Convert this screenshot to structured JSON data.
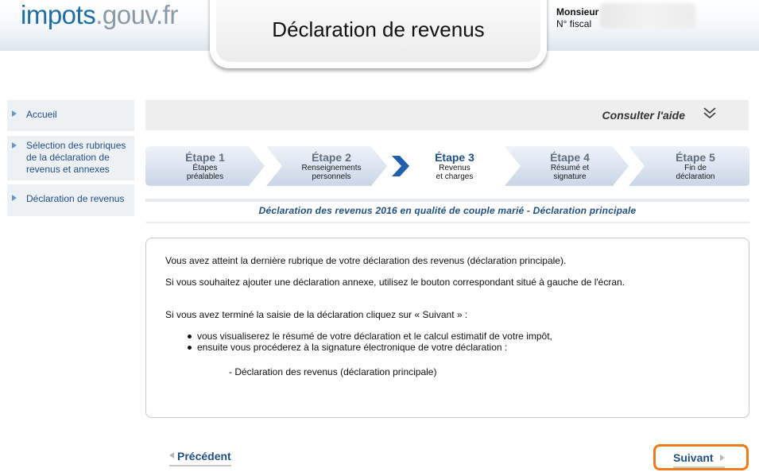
{
  "header": {
    "logo_part1": "impots",
    "logo_part2": ".gouv.fr",
    "title": "Déclaration de revenus",
    "user_name": "Monsieur",
    "fiscal_label": "N° fiscal"
  },
  "sidebar": {
    "items": [
      {
        "label": "Accueil"
      },
      {
        "label": "Sélection des rubriques de la déclaration de revenus et annexes"
      },
      {
        "label": "Déclaration de revenus"
      }
    ]
  },
  "help": {
    "label": "Consulter l'aide"
  },
  "steps": [
    {
      "title": "Étape 1",
      "line1": "Étapes",
      "line2": "préalables"
    },
    {
      "title": "Étape 2",
      "line1": "Renseignements",
      "line2": "personnels"
    },
    {
      "title": "Étape 3",
      "line1": "Revenus",
      "line2": "et charges"
    },
    {
      "title": "Étape 4",
      "line1": "Résumé et",
      "line2": "signature"
    },
    {
      "title": "Étape 5",
      "line1": "Fin de",
      "line2": "déclaration"
    }
  ],
  "subtitle": "Déclaration des revenus 2016 en qualité de couple marié - Déclaration principale",
  "content": {
    "p1": "Vous avez atteint la dernière rubrique de votre déclaration des revenus (déclaration principale).",
    "p2": "Si vous souhaitez ajouter une déclaration annexe, utilisez le bouton correspondant situé à gauche de l'écran.",
    "p3": "Si vous avez terminé la saisie de la déclaration cliquez sur « Suivant » :",
    "bullet1": "vous visualiserez le résumé de votre déclaration et le calcul estimatif de votre impôt,",
    "bullet2": "ensuite vous procéderez à la signature électronique de votre déclaration :",
    "p4": "- Déclaration des revenus (déclaration principale)"
  },
  "nav": {
    "prev_label": "Précédent",
    "next_label": "Suivant"
  },
  "colors": {
    "brand_blue": "#1e4f86",
    "logo_blue": "#1e6ea8",
    "highlight_orange": "#ef7b1a"
  }
}
